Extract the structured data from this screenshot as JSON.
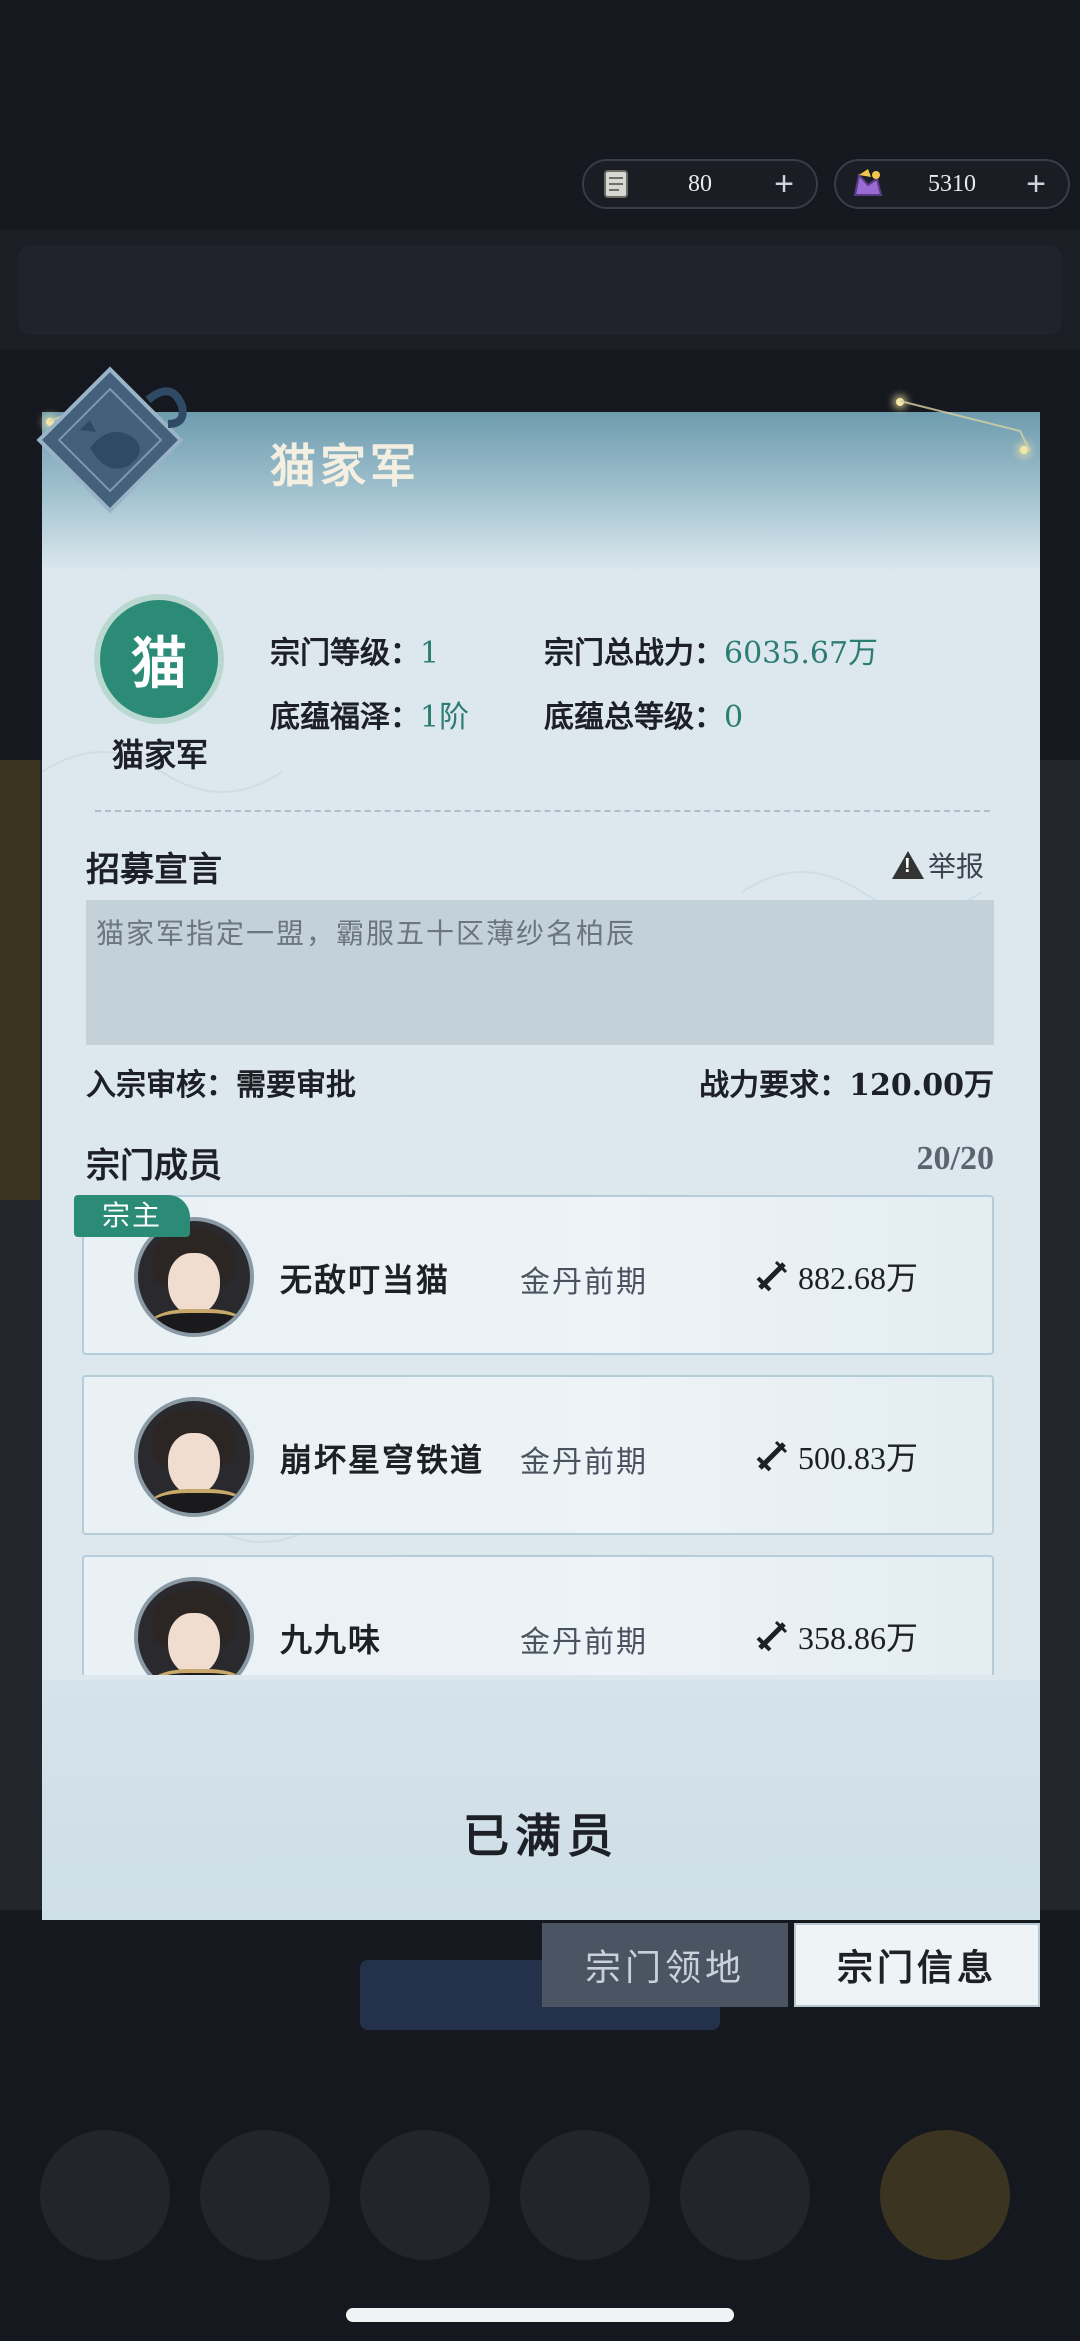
{
  "currency": {
    "item1": {
      "icon": "scroll-token-icon",
      "value": "80",
      "add": "+"
    },
    "item2": {
      "icon": "treasure-token-icon",
      "value": "5310",
      "add": "+"
    }
  },
  "panel": {
    "title": "猫家军",
    "badge_char": "猫",
    "sect_name": "猫家军",
    "info": {
      "level_label": "宗门等级：",
      "level_value": "1",
      "total_power_label": "宗门总战力：",
      "total_power_value": "6035.67万",
      "blessing_label": "底蕴福泽：",
      "blessing_value": "1阶",
      "heritage_label": "底蕴总等级：",
      "heritage_value": "0"
    },
    "recruit_title": "招募宣言",
    "report_label": "举报",
    "manifesto": "猫家军指定一盟，霸服五十区薄纱名柏辰",
    "review": "入宗审核：需要审批",
    "power_req": "战力要求：120.00万",
    "members_title": "宗门成员",
    "members_count": "20/20",
    "leader_tag": "宗主",
    "members": [
      {
        "name": "无敌叮当猫",
        "rank": "金丹前期",
        "power": "882.68万"
      },
      {
        "name": "崩坏星穹铁道",
        "rank": "金丹前期",
        "power": "500.83万"
      },
      {
        "name": "九九味",
        "rank": "金丹前期",
        "power": "358.86万"
      }
    ],
    "full_label": "已满员"
  },
  "tabs": {
    "territory": "宗门领地",
    "info": "宗门信息"
  },
  "colors": {
    "accent_green": "#2b8b77",
    "value_teal": "#2c7d72",
    "panel_bg": "#dce8ee"
  }
}
